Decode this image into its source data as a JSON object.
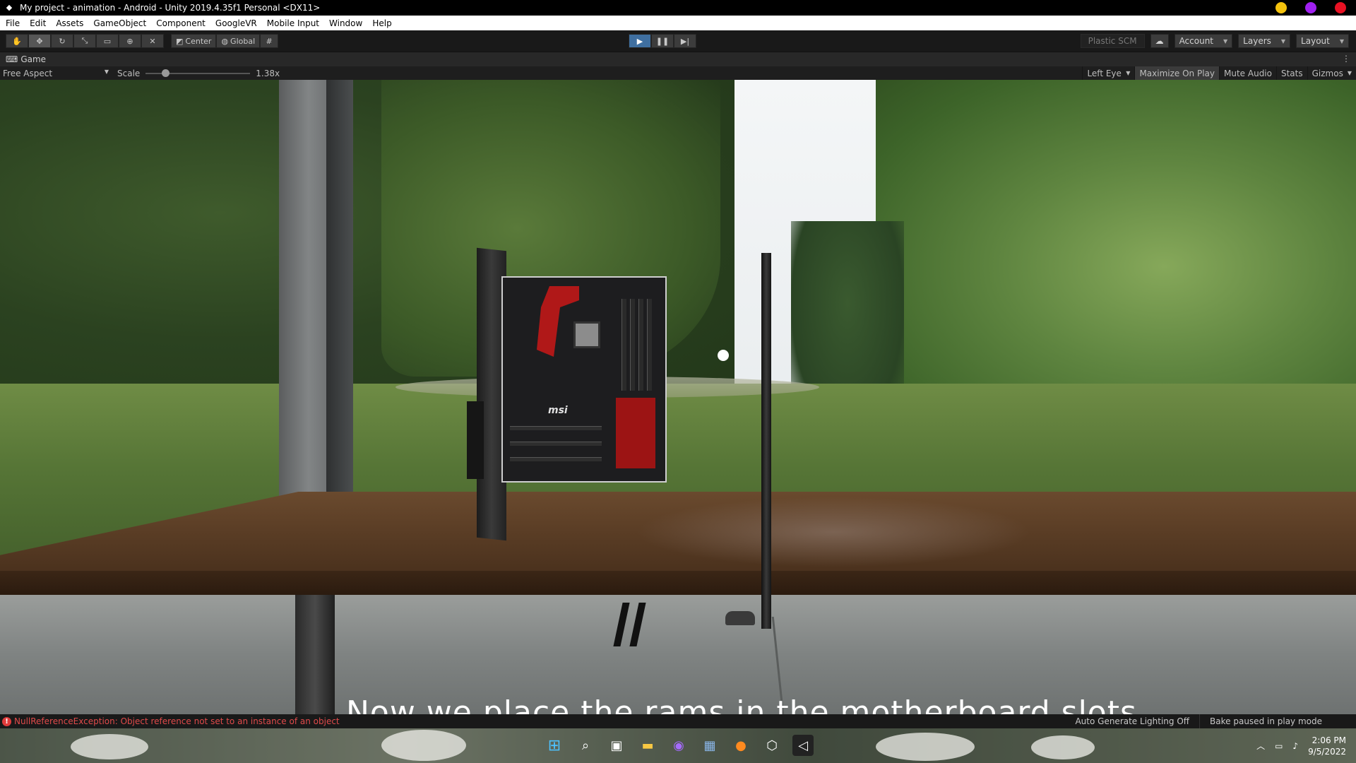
{
  "window": {
    "title": "My project - animation - Android - Unity 2019.4.35f1 Personal <DX11>",
    "controls": [
      {
        "name": "minimize",
        "color": "#f4c20d"
      },
      {
        "name": "maximize",
        "color": "#a020f0"
      },
      {
        "name": "close",
        "color": "#e81123"
      }
    ]
  },
  "menu": [
    "File",
    "Edit",
    "Assets",
    "GameObject",
    "Component",
    "GoogleVR",
    "Mobile Input",
    "Window",
    "Help"
  ],
  "toolbar": {
    "pivot_label": "Center",
    "space_label": "Global",
    "plastic_label": "Plastic SCM",
    "account_label": "Account",
    "layers_label": "Layers",
    "layout_label": "Layout"
  },
  "game_tab": {
    "label": "Game"
  },
  "game_view": {
    "aspect": "Free Aspect",
    "scale_label": "Scale",
    "scale_value": "1.38x",
    "scale_fraction": 0.19,
    "eye": "Left Eye",
    "maximize_on_play": "Maximize On Play",
    "mute_audio": "Mute Audio",
    "stats": "Stats",
    "gizmos": "Gizmos"
  },
  "scene": {
    "brand_text": "msi",
    "subtitle": "Now we place the rams in the motherboard slots"
  },
  "status": {
    "error": "NullReferenceException: Object reference not set to an instance of an object",
    "lighting": "Auto Generate Lighting Off",
    "bake": "Bake paused in play mode"
  },
  "taskbar": {
    "icons": [
      "windows-start",
      "search",
      "task-view",
      "file-explorer",
      "messenger",
      "photos",
      "firefox",
      "unity-hub",
      "unity-editor"
    ],
    "time": "2:06 PM",
    "date": "9/5/2022"
  }
}
